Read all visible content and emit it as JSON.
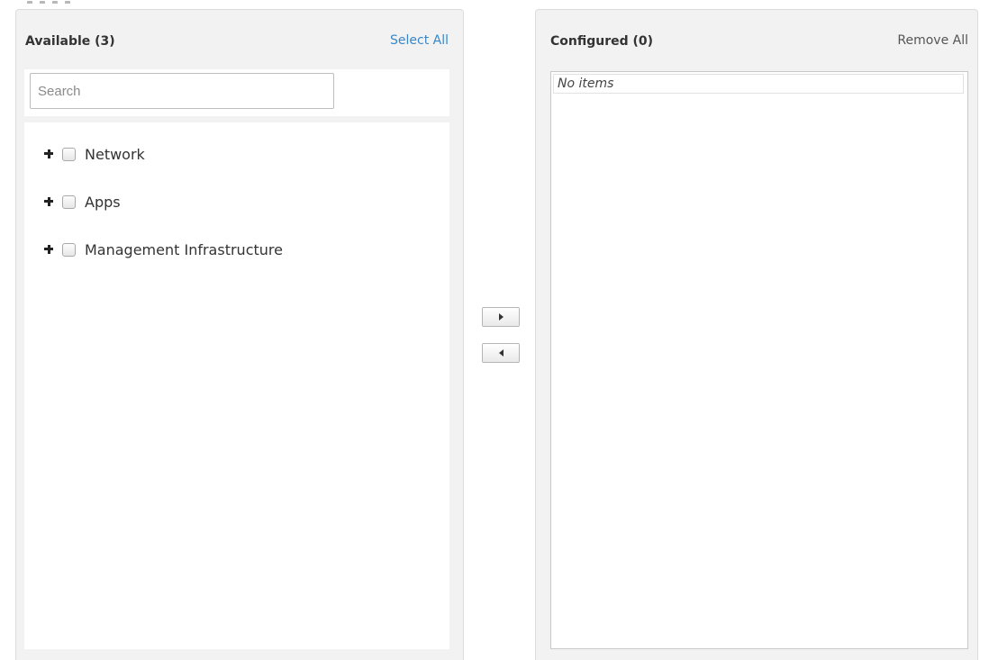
{
  "available": {
    "title": "Available (3)",
    "select_all_label": "Select All",
    "search": {
      "placeholder": "Search",
      "value": ""
    },
    "items": [
      {
        "label": "Network",
        "checked": false,
        "expand_icon": "plus-icon"
      },
      {
        "label": "Apps",
        "checked": false,
        "expand_icon": "plus-icon"
      },
      {
        "label": "Management Infrastructure",
        "checked": false,
        "expand_icon": "plus-icon"
      }
    ]
  },
  "controls": {
    "move_right_icon": "triangle-right-icon",
    "move_left_icon": "triangle-left-icon"
  },
  "configured": {
    "title": "Configured (0)",
    "remove_all_label": "Remove All",
    "empty_text": "No items"
  },
  "colors": {
    "link": "#3a87c8",
    "panel_bg": "#f2f2f2",
    "border": "#dcdcdc",
    "text": "#333333"
  }
}
